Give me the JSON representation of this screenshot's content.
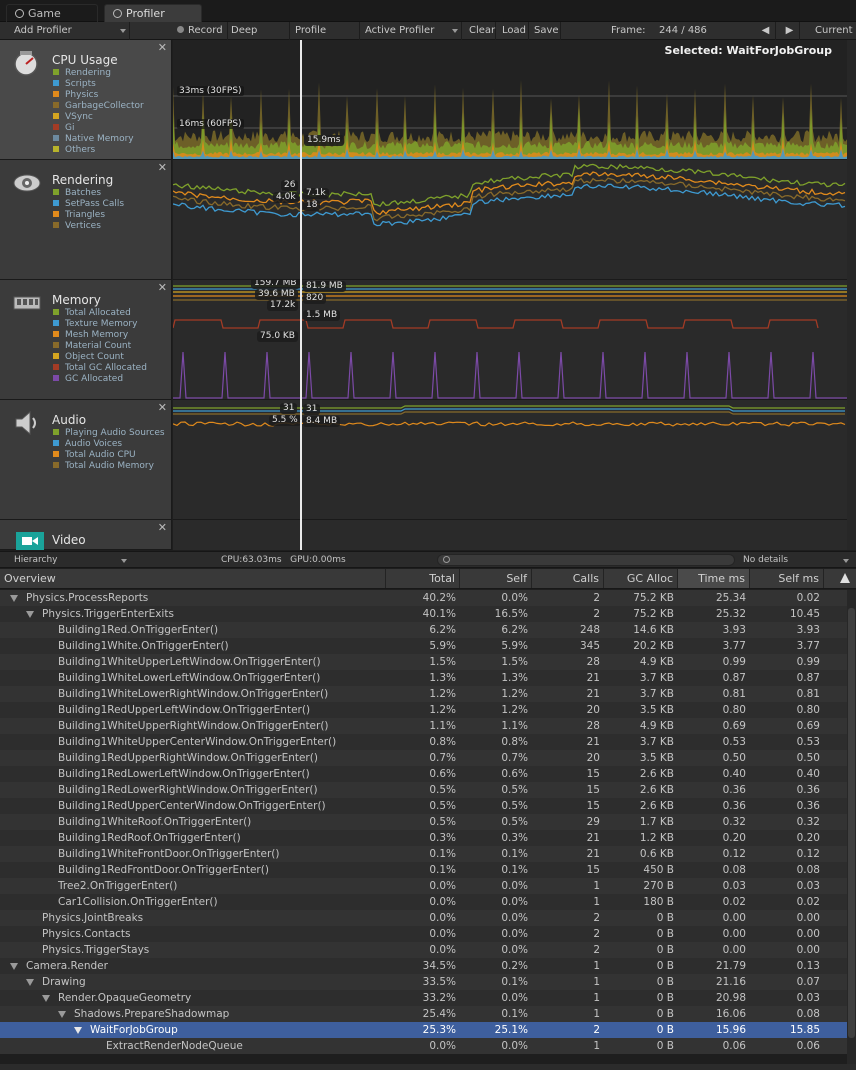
{
  "tabs": [
    {
      "label": "Game",
      "active": false
    },
    {
      "label": "Profiler",
      "active": true
    }
  ],
  "toolbar": {
    "add_profiler": "Add Profiler",
    "record": "Record",
    "deep_profile": "Deep Profile",
    "profile_editor": "Profile Editor",
    "active_profiler": "Active Profiler",
    "clear": "Clear",
    "load": "Load",
    "save": "Save",
    "frame_label": "Frame:",
    "frame_value": "244 / 486",
    "current": "Current"
  },
  "selected_label": "Selected: WaitForJobGroup",
  "modules": [
    {
      "title": "CPU Usage",
      "icon": "cpu-usage-icon",
      "items": [
        {
          "label": "Rendering",
          "color": "#7fa22b"
        },
        {
          "label": "Scripts",
          "color": "#3e9ad1"
        },
        {
          "label": "Physics",
          "color": "#e08a1c"
        },
        {
          "label": "GarbageCollector",
          "color": "#886a2a"
        },
        {
          "label": "VSync",
          "color": "#d4a520"
        },
        {
          "label": "Gi",
          "color": "#a33b25"
        },
        {
          "label": "Native Memory",
          "color": "#6d8aa0"
        },
        {
          "label": "Others",
          "color": "#b7b32b"
        }
      ]
    },
    {
      "title": "Rendering",
      "icon": "rendering-icon",
      "items": [
        {
          "label": "Batches",
          "color": "#7fa22b"
        },
        {
          "label": "SetPass Calls",
          "color": "#3e9ad1"
        },
        {
          "label": "Triangles",
          "color": "#e08a1c"
        },
        {
          "label": "Vertices",
          "color": "#886a2a"
        }
      ]
    },
    {
      "title": "Memory",
      "icon": "memory-chip-icon",
      "items": [
        {
          "label": "Total Allocated",
          "color": "#7fa22b"
        },
        {
          "label": "Texture Memory",
          "color": "#3e9ad1"
        },
        {
          "label": "Mesh Memory",
          "color": "#e08a1c"
        },
        {
          "label": "Material Count",
          "color": "#886a2a"
        },
        {
          "label": "Object Count",
          "color": "#d4a520"
        },
        {
          "label": "Total GC Allocated",
          "color": "#a33b25"
        },
        {
          "label": "GC Allocated",
          "color": "#7c4aa8"
        }
      ]
    },
    {
      "title": "Audio",
      "icon": "speaker-icon",
      "items": [
        {
          "label": "Playing Audio Sources",
          "color": "#7fa22b"
        },
        {
          "label": "Audio Voices",
          "color": "#3e9ad1"
        },
        {
          "label": "Total Audio CPU",
          "color": "#e08a1c"
        },
        {
          "label": "Total Audio Memory",
          "color": "#886a2a"
        }
      ]
    },
    {
      "title": "Video",
      "icon": "video-camera-icon",
      "items": []
    }
  ],
  "graph_labels": {
    "cpu": {
      "fps30": "33ms (30FPS)",
      "fps60": "16ms (60FPS)",
      "current": "15.9ms"
    },
    "rendering": {
      "a": "26",
      "b": "4.0k",
      "c": "7.1k",
      "d": "18"
    },
    "memory": {
      "a": "159.7 MB",
      "b": "39.6 MB",
      "c": "17.2k",
      "d": "81.9 MB",
      "e": "820",
      "f": "1.5 MB",
      "g": "75.0 KB"
    },
    "audio": {
      "a": "31",
      "b": "5.5 %",
      "c": "31",
      "d": "8.4 MB"
    }
  },
  "bottom_bar": {
    "view": "Hierarchy",
    "cpu_gpu": "CPU:63.03ms   GPU:0.00ms",
    "details": "No details"
  },
  "table": {
    "columns": [
      "Overview",
      "Total",
      "Self",
      "Calls",
      "GC Alloc",
      "Time ms",
      "Self ms"
    ],
    "rows": [
      {
        "name": "Physics.ProcessReports",
        "depth": 0,
        "expanded": true,
        "total": "40.2%",
        "self": "0.0%",
        "calls": "2",
        "gc": "75.2 KB",
        "time": "25.34",
        "selfms": "0.02"
      },
      {
        "name": "Physics.TriggerEnterExits",
        "depth": 1,
        "expanded": true,
        "total": "40.1%",
        "self": "16.5%",
        "calls": "2",
        "gc": "75.2 KB",
        "time": "25.32",
        "selfms": "10.45"
      },
      {
        "name": "Building1Red.OnTriggerEnter()",
        "depth": 2,
        "total": "6.2%",
        "self": "6.2%",
        "calls": "248",
        "gc": "14.6 KB",
        "time": "3.93",
        "selfms": "3.93"
      },
      {
        "name": "Building1White.OnTriggerEnter()",
        "depth": 2,
        "total": "5.9%",
        "self": "5.9%",
        "calls": "345",
        "gc": "20.2 KB",
        "time": "3.77",
        "selfms": "3.77"
      },
      {
        "name": "Building1WhiteUpperLeftWindow.OnTriggerEnter()",
        "depth": 2,
        "total": "1.5%",
        "self": "1.5%",
        "calls": "28",
        "gc": "4.9 KB",
        "time": "0.99",
        "selfms": "0.99"
      },
      {
        "name": "Building1WhiteLowerLeftWindow.OnTriggerEnter()",
        "depth": 2,
        "total": "1.3%",
        "self": "1.3%",
        "calls": "21",
        "gc": "3.7 KB",
        "time": "0.87",
        "selfms": "0.87"
      },
      {
        "name": "Building1WhiteLowerRightWindow.OnTriggerEnter()",
        "depth": 2,
        "total": "1.2%",
        "self": "1.2%",
        "calls": "21",
        "gc": "3.7 KB",
        "time": "0.81",
        "selfms": "0.81"
      },
      {
        "name": "Building1RedUpperLeftWindow.OnTriggerEnter()",
        "depth": 2,
        "total": "1.2%",
        "self": "1.2%",
        "calls": "20",
        "gc": "3.5 KB",
        "time": "0.80",
        "selfms": "0.80"
      },
      {
        "name": "Building1WhiteUpperRightWindow.OnTriggerEnter()",
        "depth": 2,
        "total": "1.1%",
        "self": "1.1%",
        "calls": "28",
        "gc": "4.9 KB",
        "time": "0.69",
        "selfms": "0.69"
      },
      {
        "name": "Building1WhiteUpperCenterWindow.OnTriggerEnter()",
        "depth": 2,
        "total": "0.8%",
        "self": "0.8%",
        "calls": "21",
        "gc": "3.7 KB",
        "time": "0.53",
        "selfms": "0.53"
      },
      {
        "name": "Building1RedUpperRightWindow.OnTriggerEnter()",
        "depth": 2,
        "total": "0.7%",
        "self": "0.7%",
        "calls": "20",
        "gc": "3.5 KB",
        "time": "0.50",
        "selfms": "0.50"
      },
      {
        "name": "Building1RedLowerLeftWindow.OnTriggerEnter()",
        "depth": 2,
        "total": "0.6%",
        "self": "0.6%",
        "calls": "15",
        "gc": "2.6 KB",
        "time": "0.40",
        "selfms": "0.40"
      },
      {
        "name": "Building1RedLowerRightWindow.OnTriggerEnter()",
        "depth": 2,
        "total": "0.5%",
        "self": "0.5%",
        "calls": "15",
        "gc": "2.6 KB",
        "time": "0.36",
        "selfms": "0.36"
      },
      {
        "name": "Building1RedUpperCenterWindow.OnTriggerEnter()",
        "depth": 2,
        "total": "0.5%",
        "self": "0.5%",
        "calls": "15",
        "gc": "2.6 KB",
        "time": "0.36",
        "selfms": "0.36"
      },
      {
        "name": "Building1WhiteRoof.OnTriggerEnter()",
        "depth": 2,
        "total": "0.5%",
        "self": "0.5%",
        "calls": "29",
        "gc": "1.7 KB",
        "time": "0.32",
        "selfms": "0.32"
      },
      {
        "name": "Building1RedRoof.OnTriggerEnter()",
        "depth": 2,
        "total": "0.3%",
        "self": "0.3%",
        "calls": "21",
        "gc": "1.2 KB",
        "time": "0.20",
        "selfms": "0.20"
      },
      {
        "name": "Building1WhiteFrontDoor.OnTriggerEnter()",
        "depth": 2,
        "total": "0.1%",
        "self": "0.1%",
        "calls": "21",
        "gc": "0.6 KB",
        "time": "0.12",
        "selfms": "0.12"
      },
      {
        "name": "Building1RedFrontDoor.OnTriggerEnter()",
        "depth": 2,
        "total": "0.1%",
        "self": "0.1%",
        "calls": "15",
        "gc": "450 B",
        "time": "0.08",
        "selfms": "0.08"
      },
      {
        "name": "Tree2.OnTriggerEnter()",
        "depth": 2,
        "total": "0.0%",
        "self": "0.0%",
        "calls": "1",
        "gc": "270 B",
        "time": "0.03",
        "selfms": "0.03"
      },
      {
        "name": "Car1Collision.OnTriggerEnter()",
        "depth": 2,
        "total": "0.0%",
        "self": "0.0%",
        "calls": "1",
        "gc": "180 B",
        "time": "0.02",
        "selfms": "0.02"
      },
      {
        "name": "Physics.JointBreaks",
        "depth": 1,
        "total": "0.0%",
        "self": "0.0%",
        "calls": "2",
        "gc": "0 B",
        "time": "0.00",
        "selfms": "0.00"
      },
      {
        "name": "Physics.Contacts",
        "depth": 1,
        "total": "0.0%",
        "self": "0.0%",
        "calls": "2",
        "gc": "0 B",
        "time": "0.00",
        "selfms": "0.00"
      },
      {
        "name": "Physics.TriggerStays",
        "depth": 1,
        "total": "0.0%",
        "self": "0.0%",
        "calls": "2",
        "gc": "0 B",
        "time": "0.00",
        "selfms": "0.00"
      },
      {
        "name": "Camera.Render",
        "depth": 0,
        "expanded": true,
        "total": "34.5%",
        "self": "0.2%",
        "calls": "1",
        "gc": "0 B",
        "time": "21.79",
        "selfms": "0.13"
      },
      {
        "name": "Drawing",
        "depth": 1,
        "expanded": true,
        "total": "33.5%",
        "self": "0.1%",
        "calls": "1",
        "gc": "0 B",
        "time": "21.16",
        "selfms": "0.07"
      },
      {
        "name": "Render.OpaqueGeometry",
        "depth": 2,
        "expanded": true,
        "total": "33.2%",
        "self": "0.0%",
        "calls": "1",
        "gc": "0 B",
        "time": "20.98",
        "selfms": "0.03"
      },
      {
        "name": "Shadows.PrepareShadowmap",
        "depth": 3,
        "expanded": true,
        "total": "25.4%",
        "self": "0.1%",
        "calls": "1",
        "gc": "0 B",
        "time": "16.06",
        "selfms": "0.08"
      },
      {
        "name": "WaitForJobGroup",
        "depth": 4,
        "expanded": true,
        "selected": true,
        "total": "25.3%",
        "self": "25.1%",
        "calls": "2",
        "gc": "0 B",
        "time": "15.96",
        "selfms": "15.85"
      },
      {
        "name": "ExtractRenderNodeQueue",
        "depth": 5,
        "total": "0.0%",
        "self": "0.0%",
        "calls": "1",
        "gc": "0 B",
        "time": "0.06",
        "selfms": "0.06"
      }
    ]
  }
}
